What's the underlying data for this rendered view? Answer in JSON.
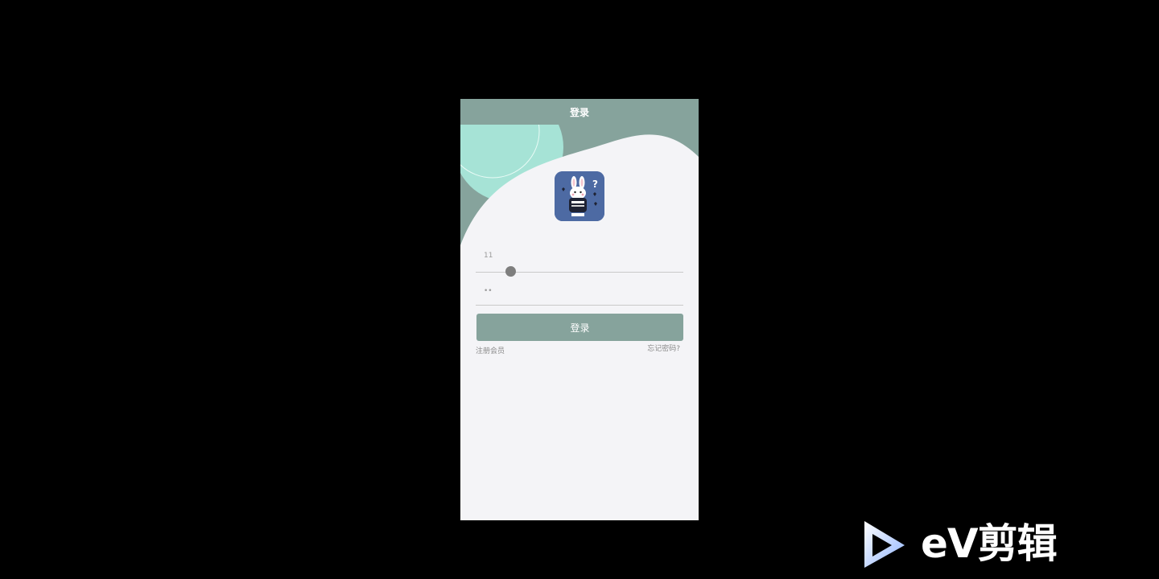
{
  "nav": {
    "title": "登录"
  },
  "form": {
    "account_value": "11",
    "account_slider_fraction": 0.17,
    "password_value": "••",
    "login_button": "登录"
  },
  "links": {
    "register": "注册会员",
    "forgot": "忘记密码?"
  },
  "watermark": {
    "text": "eV剪辑"
  },
  "colors": {
    "primary": "#86a39c",
    "background": "#f4f4f7",
    "accent_mint": "#a6e3d6",
    "logo_bg": "#4d6aa3"
  },
  "icons": {
    "logo": "rabbit-avatar-icon",
    "watermark": "play-triangle-icon"
  }
}
